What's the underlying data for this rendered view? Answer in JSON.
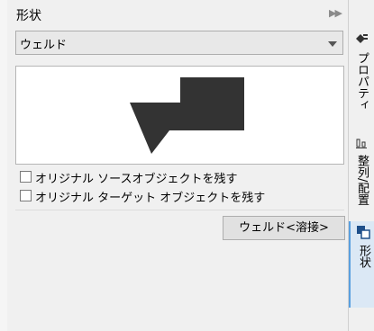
{
  "panel": {
    "title": "形状",
    "mode_selected": "ウェルド",
    "checkboxes": [
      {
        "label": "オリジナル ソースオブジェクトを残す",
        "checked": false
      },
      {
        "label": "オリジナル ターゲット オブジェクトを残す",
        "checked": false
      }
    ],
    "apply_button": "ウェルド<溶接>"
  },
  "dock_tabs": [
    {
      "label": "プロパティ",
      "icon": "properties-icon"
    },
    {
      "label": "整列/配置",
      "icon": "align-icon"
    },
    {
      "label": "形状",
      "icon": "shape-icon",
      "active": true
    }
  ],
  "colors": {
    "preview_shape": "#333333",
    "active_tab": "#dbe8f5",
    "active_tab_border": "#5aa0e0"
  }
}
